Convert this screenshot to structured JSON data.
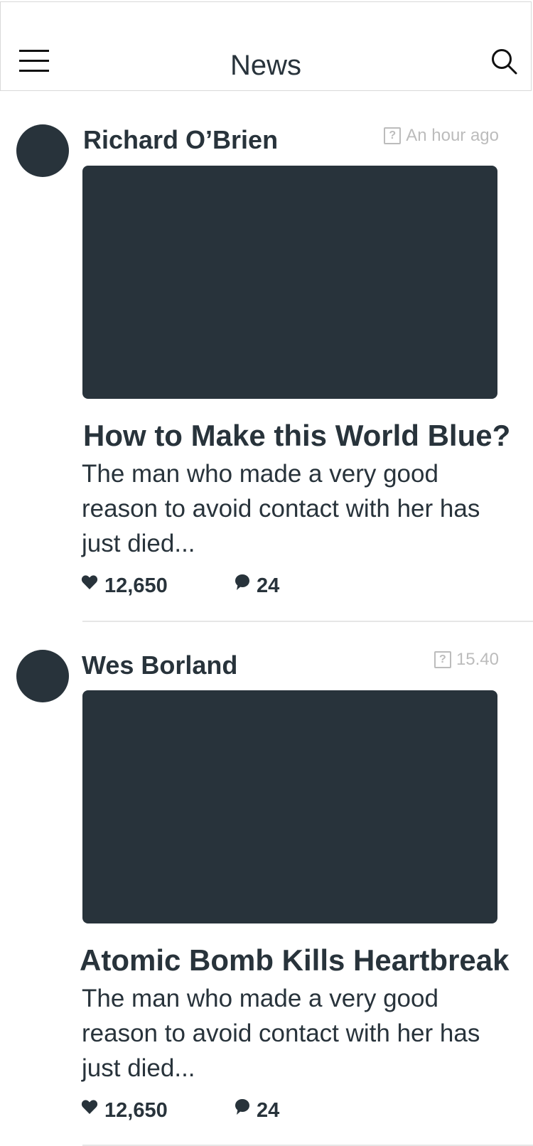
{
  "header": {
    "title": "News",
    "menu_icon": "hamburger-menu-icon",
    "search_icon": "search-icon"
  },
  "posts": [
    {
      "author": "Richard O’Brien",
      "time": "An hour ago",
      "time_icon": "?",
      "title": "How to Make this World Blue?",
      "excerpt": "The man who made a very good reason to avoid contact with her has just died...",
      "likes": "12,650",
      "comments": "24"
    },
    {
      "author": "Wes Borland",
      "time": "15.40",
      "time_icon": "?",
      "title": "Atomic Bomb Kills Heartbreak",
      "excerpt": "The man who made a very good reason to avoid contact with her has just died...",
      "likes": "12,650",
      "comments": "24"
    }
  ],
  "colors": {
    "primary_text": "#28333b",
    "muted_text": "#bcbcbc",
    "divider": "#e6e6e6",
    "placeholder": "#28333b"
  }
}
